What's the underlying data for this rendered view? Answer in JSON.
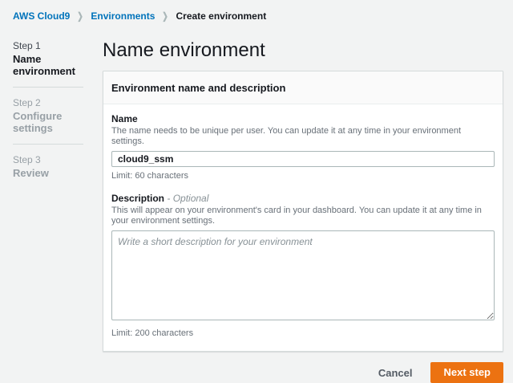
{
  "breadcrumb": {
    "separator": "❯",
    "items": [
      {
        "label": "AWS Cloud9"
      },
      {
        "label": "Environments"
      },
      {
        "label": "Create environment"
      }
    ]
  },
  "sidebar": {
    "steps": [
      {
        "step": "Step 1",
        "title": "Name environment"
      },
      {
        "step": "Step 2",
        "title": "Configure settings"
      },
      {
        "step": "Step 3",
        "title": "Review"
      }
    ]
  },
  "main": {
    "title": "Name environment",
    "card": {
      "header": "Environment name and description",
      "name_field": {
        "label": "Name",
        "help": "The name needs to be unique per user. You can update it at any time in your environment settings.",
        "value": "cloud9_ssm",
        "limit": "Limit: 60 characters"
      },
      "description_field": {
        "label": "Description",
        "optional": "- Optional",
        "help": "This will appear on your environment's card in your dashboard. You can update it at any time in your environment settings.",
        "placeholder": "Write a short description for your environment",
        "limit": "Limit: 200 characters"
      }
    },
    "actions": {
      "cancel": "Cancel",
      "next": "Next step"
    }
  },
  "colors": {
    "accent_orange": "#ec7211",
    "link_blue": "#0073bb",
    "text_dark": "#16191f",
    "text_muted": "#687078",
    "page_background": "#f2f3f3"
  }
}
